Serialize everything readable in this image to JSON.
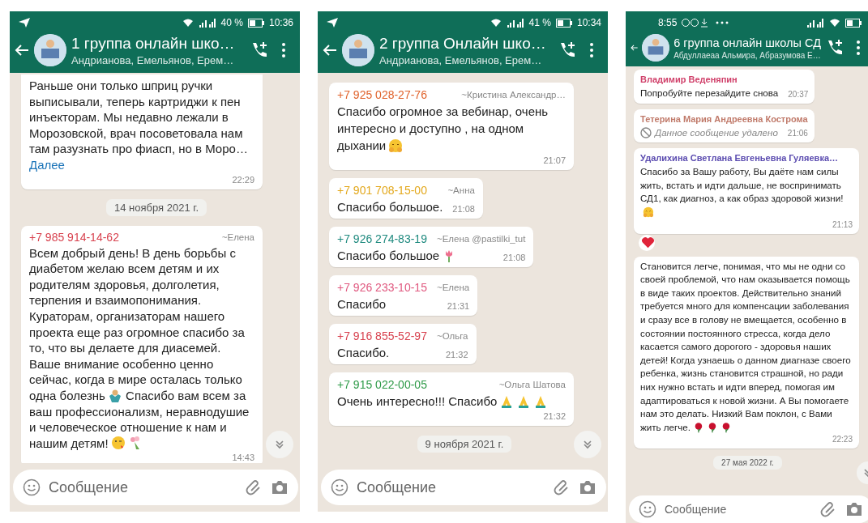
{
  "phones": [
    {
      "status_bar": {
        "kind": "standard",
        "battery": "40 %",
        "time": "10:36"
      },
      "header": {
        "title": "1 группа онлайн шко…",
        "subtitle": "Андрианова, Емельянов, Ерем…"
      },
      "messages": [
        {
          "kind": "message",
          "parts": [
            {
              "kind": "text",
              "text": "Раньше они только шприц ручки выписывали, теперь картриджи к пен инъекторам. Мы недавно лежали в Морозовской, врач посоветовала нам там разузнать про фиасп, но в Моро… "
            }
          ],
          "more_link": "Далее",
          "time": "22:29"
        },
        {
          "kind": "date",
          "text": "14 ноября 2021 г."
        },
        {
          "kind": "message",
          "sender_phone": "+7 985 914-14-62",
          "sender_name": "~Елена",
          "color": "#d8424f",
          "parts": [
            {
              "kind": "text",
              "text": "Всем добрый день! В день борьбы с диабетом желаю всем детям и их родителям здоровья, долголетия, терпения и взаимопонимания. Кураторам, организаторам нашего проекта еще раз огромное спасибо за то, что вы делаете для диасемей. Ваше внимание особенно ценно сейчас, когда в мире осталась только одна болезнь"
            },
            {
              "kind": "shrug"
            },
            {
              "kind": "text",
              "text": " Спасибо вам всем за ваш профессионализм, неравнодушие и человеческое отношение к нам и нашим детям!"
            },
            {
              "kind": "kiss"
            },
            {
              "kind": "bouquet"
            }
          ],
          "time": "14:43"
        }
      ],
      "composer": {
        "placeholder": "Сообщение"
      }
    },
    {
      "status_bar": {
        "kind": "standard",
        "battery": "41 %",
        "time": "10:34"
      },
      "header": {
        "title": "2 группа Онлайн шко…",
        "subtitle": "Андрианова, Емельянов, Ерем…"
      },
      "messages": [
        {
          "kind": "message",
          "sender_phone": "+7 925 028-27-76",
          "sender_name": "~Кристина Александр…",
          "color": "#e0632c",
          "parts": [
            {
              "kind": "text",
              "text": "Спасибо огромное за вебинар, очень интересно и доступно , на одном дыхании"
            },
            {
              "kind": "hug"
            }
          ],
          "time": "21:07"
        },
        {
          "kind": "message",
          "sender_phone": "+7 901 708-15-00",
          "sender_name": "~Анна",
          "color": "#e3a81c",
          "parts": [
            {
              "kind": "text",
              "text": "Спасибо большое."
            }
          ],
          "time": "21:08"
        },
        {
          "kind": "message",
          "sender_phone": "+7 926 274-83-19",
          "sender_name": "~Елена @pastilki_tut",
          "color": "#1f8a7f",
          "parts": [
            {
              "kind": "text",
              "text": "Спасибо большое"
            },
            {
              "kind": "tulip"
            }
          ],
          "time": "21:08"
        },
        {
          "kind": "message",
          "sender_phone": "+7 926 233-10-15",
          "sender_name": "~Елена",
          "color": "#e0587f",
          "parts": [
            {
              "kind": "text",
              "text": "Спасибо"
            }
          ],
          "time": "21:31"
        },
        {
          "kind": "message",
          "sender_phone": "+7 916 855-52-97",
          "sender_name": "~Ольга",
          "color": "#d8424f",
          "parts": [
            {
              "kind": "text",
              "text": "Спасибо."
            }
          ],
          "time": "21:32"
        },
        {
          "kind": "message",
          "sender_phone": "+7 915 022-00-05",
          "sender_name": "~Ольга Шатова",
          "color": "#2e9a48",
          "parts": [
            {
              "kind": "text",
              "text": "Очень интересно!!! Спасибо"
            },
            {
              "kind": "pray"
            },
            {
              "kind": "pray"
            },
            {
              "kind": "pray"
            }
          ],
          "time": "21:32"
        },
        {
          "kind": "date",
          "text": "9 ноября 2021 г."
        }
      ],
      "composer": {
        "placeholder": "Сообщение"
      }
    },
    {
      "status_bar": {
        "kind": "compact",
        "time": "8:55"
      },
      "header": {
        "title": "6 группа онлайн школы СД",
        "subtitle": "Абдуллаеаа Альмира, Абразумова Е…"
      },
      "messages": [
        {
          "kind": "message",
          "sender": "Владимир Веденяпин",
          "color": "#d0406a",
          "parts": [
            {
              "kind": "text",
              "text": "Попробуйте перезайдите снова"
            }
          ],
          "time": "20:37"
        },
        {
          "kind": "deleted",
          "sender": "Тетерина Мария Андреевна Кострома",
          "color": "#c07a6a",
          "text": "Данное сообщение удалено",
          "time": "21:06"
        },
        {
          "kind": "message",
          "sender": "Удалихина Светлана Евгеньевна Гуляевка…",
          "color": "#5b4cb0",
          "parts": [
            {
              "kind": "text",
              "text": "Спасибо за Вашу работу, Вы даёте нам силы жить, встать и идти дальше, не воспринимать СД1, как диагноз, а как образ здоровой жизни!"
            },
            {
              "kind": "hug"
            }
          ],
          "time": "21:13",
          "reaction": {
            "kind": "heart"
          }
        },
        {
          "kind": "message",
          "parts": [
            {
              "kind": "text",
              "text": "Становится легче, понимая, что мы не одни со своей проблемой, что нам оказывается помощь в виде таких проектов. Действительно знаний требуется много для компенсации заболевания и сразу все в голову не вмещается, особенно в состоянии постоянного стресса, когда дело касается самого дорогого - здоровья наших детей! Когда узнаешь о данном диагназе своего ребенка, жизнь становится страшной, но ради них нужно встать и идти вперед, помогая им адаптироваться к новой жизни. А Вы помогаете нам это делать. Низкий Вам поклон, с Вами жить легче."
            },
            {
              "kind": "rose"
            },
            {
              "kind": "rose"
            },
            {
              "kind": "rose"
            }
          ],
          "time": "22:23"
        },
        {
          "kind": "date",
          "text": "27 мая 2022 г."
        }
      ],
      "composer": {
        "placeholder": "Сообщение"
      }
    }
  ]
}
